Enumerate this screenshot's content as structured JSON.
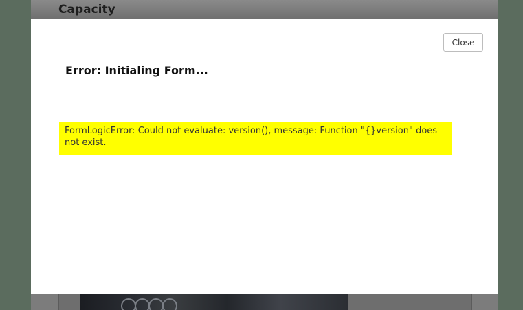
{
  "background_page": {
    "title": "Capacity"
  },
  "modal": {
    "close_label": "Close",
    "title": "Error: Initialing Form...",
    "error_message": "FormLogicError: Could not evaluate: version(), message: Function \"{}version\" does not exist."
  },
  "colors": {
    "error_highlight": "#ffff00",
    "backdrop": "#5b6c5e",
    "modal_background": "#ffffff"
  }
}
